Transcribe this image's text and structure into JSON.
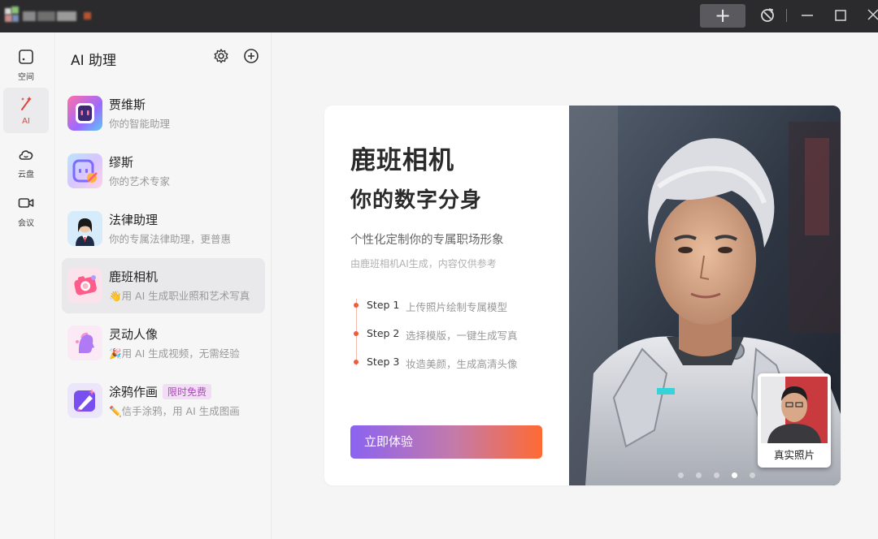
{
  "titlebar": {
    "new_tab_label": "+"
  },
  "rail": {
    "items": [
      {
        "label": "空间",
        "icon": "space-icon"
      },
      {
        "label": "AI",
        "icon": "ai-wand-icon"
      },
      {
        "label": "云盘",
        "icon": "cloud-icon"
      },
      {
        "label": "会议",
        "icon": "video-camera-icon"
      }
    ],
    "active_index": 1,
    "active_color": "#e0443a"
  },
  "panel": {
    "title": "AI 助理",
    "assistants": [
      {
        "name": "贾维斯",
        "desc": "你的智能助理"
      },
      {
        "name": "缪斯",
        "desc": "你的艺术专家"
      },
      {
        "name": "法律助理",
        "desc": "你的专属法律助理，更普惠"
      },
      {
        "name": "鹿班相机",
        "desc": "👋用 AI 生成职业照和艺术写真"
      },
      {
        "name": "灵动人像",
        "desc": "🎉用 AI 生成视频，无需经验"
      },
      {
        "name": "涂鸦作画",
        "desc": "✏️信手涂鸦，用 AI 生成图画",
        "badge": "限时免费"
      }
    ],
    "active_index": 3
  },
  "hero": {
    "title": "鹿班相机",
    "subtitle": "你的数字分身",
    "description": "个性化定制你的专属职场形象",
    "note": "由鹿班相机AI生成，内容仅供参考",
    "steps": [
      {
        "label": "Step 1",
        "text": "上传照片绘制专属模型"
      },
      {
        "label": "Step 2",
        "text": "选择模版，一键生成写真"
      },
      {
        "label": "Step 3",
        "text": "妆造美颜，生成高清头像"
      }
    ],
    "cta_label": "立即体验",
    "thumb_label": "真实照片",
    "carousel_count": 5,
    "carousel_active": 3,
    "accent_color": "#f25a3c"
  }
}
